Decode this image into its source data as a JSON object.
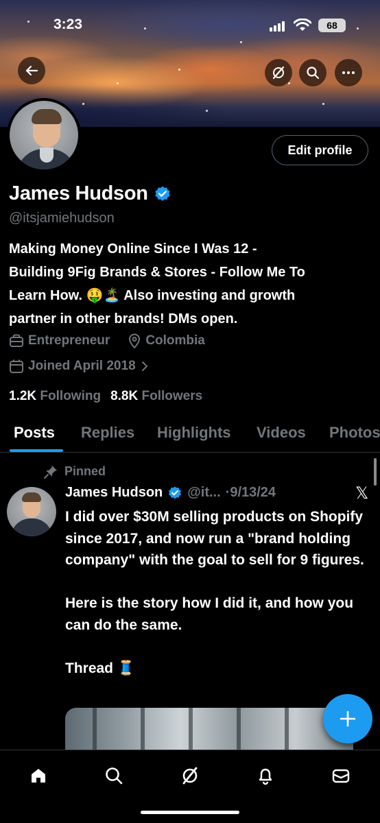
{
  "status_bar": {
    "time": "3:23",
    "battery": "68"
  },
  "profile": {
    "edit_button": "Edit profile",
    "name": "James Hudson",
    "handle": "@itsjamiehudson",
    "bio_line1": "Making Money Online Since I Was 12 -",
    "bio_line2": "Building 9Fig Brands & Stores - Follow Me To",
    "bio_line3": "Learn How. 🤑🏝️ Also investing and growth",
    "bio_line4": "partner in other brands! DMs open.",
    "category": "Entrepreneur",
    "location": "Colombia",
    "joined": "Joined April 2018",
    "following_count": "1.2K",
    "following_label": "Following",
    "followers_count": "8.8K",
    "followers_label": "Followers"
  },
  "tabs": [
    "Posts",
    "Replies",
    "Highlights",
    "Videos",
    "Photos"
  ],
  "post": {
    "pinned_label": "Pinned",
    "author": "James Hudson",
    "handle": "@it...",
    "date": "·9/13/24",
    "text_p1": "I did over $30M selling products on Shopify since 2017, and now run a \"brand holding company\" with the goal to sell for 9 figures.",
    "text_p2": "Here is the story how I did it, and how you can do the same.",
    "text_p3": "Thread 🧵"
  },
  "colors": {
    "accent": "#1d9bf0",
    "muted": "#71767b",
    "background": "#000000"
  },
  "icons": [
    "back-arrow-icon",
    "grok-icon",
    "search-icon",
    "more-icon",
    "verified-badge-icon",
    "briefcase-icon",
    "location-pin-icon",
    "calendar-icon",
    "chevron-right-icon",
    "pin-icon",
    "x-logo-icon",
    "plus-icon",
    "home-icon",
    "notifications-icon",
    "messages-icon"
  ]
}
